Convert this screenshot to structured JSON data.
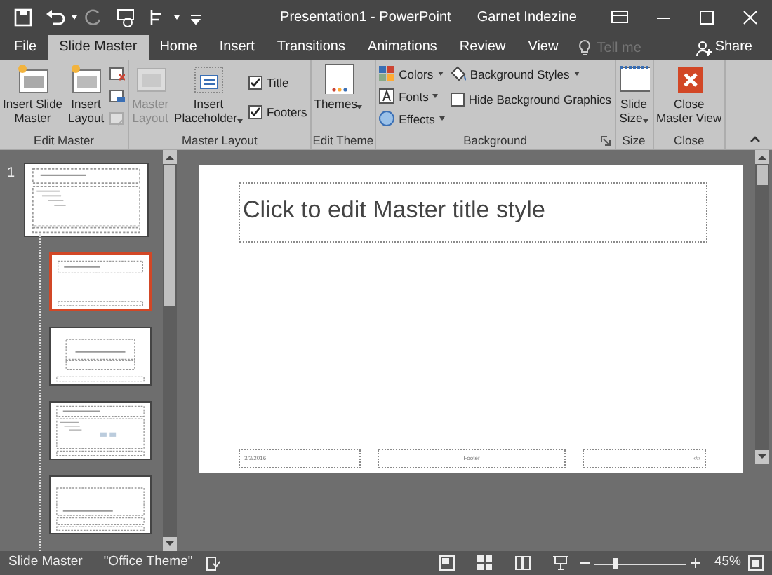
{
  "window": {
    "title": "Presentation1 - PowerPoint",
    "user": "Garnet Indezine"
  },
  "tabs": [
    {
      "label": "File",
      "selected": false
    },
    {
      "label": "Slide Master",
      "selected": true
    },
    {
      "label": "Home",
      "selected": false
    },
    {
      "label": "Insert",
      "selected": false
    },
    {
      "label": "Transitions",
      "selected": false
    },
    {
      "label": "Animations",
      "selected": false
    },
    {
      "label": "Review",
      "selected": false
    },
    {
      "label": "View",
      "selected": false
    }
  ],
  "tell_me": {
    "placeholder": "Tell me"
  },
  "share": {
    "label": "Share"
  },
  "ribbon_groups": [
    {
      "label": "Edit Master",
      "columns": [
        [
          {
            "kind": "large",
            "label": "Insert Slide\nMaster",
            "disabled": false,
            "menu": false
          }
        ],
        [
          {
            "kind": "large",
            "label": "Insert\nLayout",
            "disabled": false,
            "menu": false
          }
        ],
        [
          {
            "kind": "icon",
            "disabled": false
          },
          {
            "kind": "icon",
            "disabled": false
          },
          {
            "kind": "icon",
            "disabled": true
          }
        ]
      ]
    },
    {
      "label": "Master Layout",
      "columns": [
        [
          {
            "kind": "large",
            "label": "Master\nLayout",
            "disabled": true,
            "menu": false
          }
        ],
        [
          {
            "kind": "large",
            "label": "Insert\nPlaceholder",
            "disabled": false,
            "menu": true
          }
        ],
        [
          {
            "kind": "check",
            "label": "Title",
            "checked": true
          },
          {
            "kind": "check",
            "label": "Footers",
            "checked": true
          }
        ]
      ]
    },
    {
      "label": "Edit Theme",
      "columns": [
        [
          {
            "kind": "large",
            "label": "Themes",
            "disabled": false,
            "menu": true
          }
        ]
      ]
    },
    {
      "label": "Background",
      "launcher": true,
      "columns": [
        [
          {
            "kind": "small",
            "label": "Colors",
            "disabled": false,
            "menu": true
          },
          {
            "kind": "small",
            "label": "Fonts",
            "disabled": false,
            "menu": true
          },
          {
            "kind": "small",
            "label": "Effects",
            "disabled": false,
            "menu": true
          }
        ],
        [
          {
            "kind": "small",
            "label": "Background Styles",
            "disabled": false,
            "menu": true
          },
          {
            "kind": "check",
            "label": "Hide Background Graphics",
            "checked": false
          }
        ]
      ]
    },
    {
      "label": "Size",
      "columns": [
        [
          {
            "kind": "large",
            "label": "Slide\nSize",
            "disabled": false,
            "menu": true
          }
        ]
      ]
    },
    {
      "label": "Close",
      "columns": [
        [
          {
            "kind": "large",
            "label": "Close\nMaster View",
            "disabled": false,
            "menu": false
          }
        ]
      ]
    }
  ],
  "thumbnails": [
    {
      "number": "1",
      "kind": "master",
      "selected": false,
      "children": [
        {
          "kind": "title-only",
          "selected": true
        },
        {
          "kind": "title-slide",
          "selected": false
        },
        {
          "kind": "title-content",
          "selected": false
        },
        {
          "kind": "section",
          "selected": false
        }
      ]
    }
  ],
  "slide": {
    "title": "Click to edit Master title style",
    "date": "3/3/2016",
    "footer": "Footer",
    "number": "‹#›"
  },
  "status_bar": {
    "view": "Slide Master",
    "theme": "\"Office Theme\"",
    "zoom": {
      "level": 0.22,
      "reading": "45%"
    }
  }
}
